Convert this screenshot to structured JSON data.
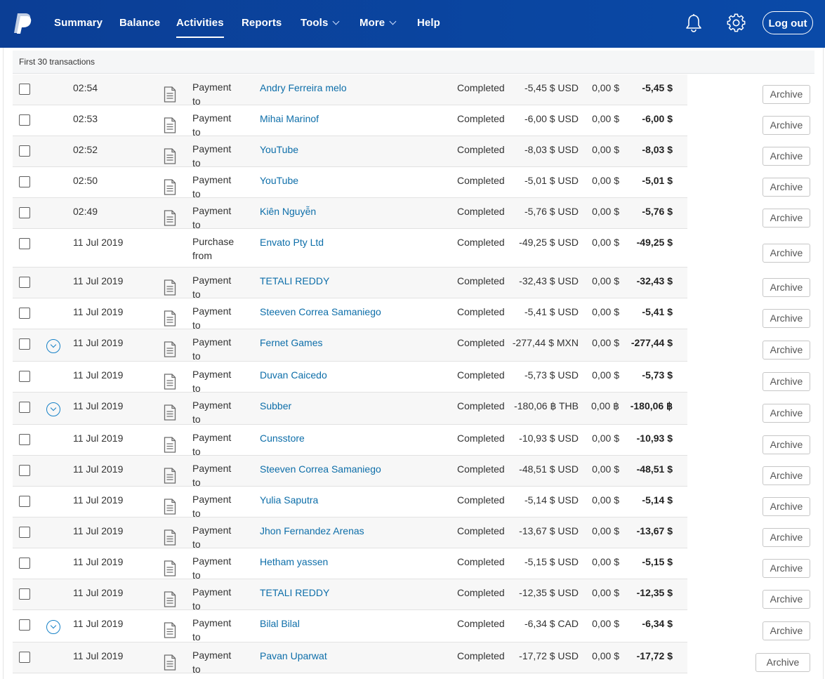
{
  "header": {
    "nav": [
      {
        "label": "Summary"
      },
      {
        "label": "Balance"
      },
      {
        "label": "Activities",
        "active": true
      },
      {
        "label": "Reports"
      },
      {
        "label": "Tools",
        "has_dropdown": true
      },
      {
        "label": "More",
        "has_dropdown": true
      },
      {
        "label": "Help"
      }
    ],
    "icons": [
      "paypal-logo",
      "bell-icon",
      "gear-icon"
    ],
    "logout_label": "Log out",
    "brand_color": "#0a3c93"
  },
  "table": {
    "caption": "First 30 transactions",
    "archive_label": "Archive",
    "link_color": "#0d6ea9",
    "rows": [
      {
        "date": "02:54",
        "type": "Payment to",
        "name": "Andry Ferreira melo",
        "status": "Completed",
        "gross": "-5,45 $ USD",
        "fee": "0,00 $",
        "net": "-5,45 $",
        "has_doc": true,
        "expandable": false
      },
      {
        "date": "02:53",
        "type": "Payment to",
        "name": "Mihai Marinof",
        "status": "Completed",
        "gross": "-6,00 $ USD",
        "fee": "0,00 $",
        "net": "-6,00 $",
        "has_doc": true,
        "expandable": false
      },
      {
        "date": "02:52",
        "type": "Payment to",
        "name": "YouTube",
        "status": "Completed",
        "gross": "-8,03 $ USD",
        "fee": "0,00 $",
        "net": "-8,03 $",
        "has_doc": true,
        "expandable": false
      },
      {
        "date": "02:50",
        "type": "Payment to",
        "name": "YouTube",
        "status": "Completed",
        "gross": "-5,01 $ USD",
        "fee": "0,00 $",
        "net": "-5,01 $",
        "has_doc": true,
        "expandable": false
      },
      {
        "date": "02:49",
        "type": "Payment to",
        "name": "Kiên Nguyễn",
        "status": "Completed",
        "gross": "-5,76 $ USD",
        "fee": "0,00 $",
        "net": "-5,76 $",
        "has_doc": true,
        "expandable": false
      },
      {
        "date": "11 Jul 2019",
        "type": "Purchase from",
        "name": "Envato Pty Ltd",
        "status": "Completed",
        "gross": "-49,25 $ USD",
        "fee": "0,00 $",
        "net": "-49,25 $",
        "has_doc": false,
        "expandable": false
      },
      {
        "date": "11 Jul 2019",
        "type": "Payment to",
        "name": "TETALI REDDY",
        "status": "Completed",
        "gross": "-32,43 $ USD",
        "fee": "0,00 $",
        "net": "-32,43 $",
        "has_doc": true,
        "expandable": false
      },
      {
        "date": "11 Jul 2019",
        "type": "Payment to",
        "name": "Steeven Correa Samaniego",
        "status": "Completed",
        "gross": "-5,41 $ USD",
        "fee": "0,00 $",
        "net": "-5,41 $",
        "has_doc": true,
        "expandable": false
      },
      {
        "date": "11 Jul 2019",
        "type": "Payment to",
        "name": "Fernet Games",
        "status": "Completed",
        "gross": "-277,44 $ MXN",
        "fee": "0,00 $",
        "net": "-277,44 $",
        "has_doc": true,
        "expandable": true
      },
      {
        "date": "11 Jul 2019",
        "type": "Payment to",
        "name": "Duvan Caicedo",
        "status": "Completed",
        "gross": "-5,73 $ USD",
        "fee": "0,00 $",
        "net": "-5,73 $",
        "has_doc": true,
        "expandable": false
      },
      {
        "date": "11 Jul 2019",
        "type": "Payment to",
        "name": "Subber",
        "status": "Completed",
        "gross": "-180,06 ฿ THB",
        "fee": "0,00 ฿",
        "net": "-180,06 ฿",
        "has_doc": true,
        "expandable": true
      },
      {
        "date": "11 Jul 2019",
        "type": "Payment to",
        "name": "Cunsstore",
        "status": "Completed",
        "gross": "-10,93 $ USD",
        "fee": "0,00 $",
        "net": "-10,93 $",
        "has_doc": true,
        "expandable": false
      },
      {
        "date": "11 Jul 2019",
        "type": "Payment to",
        "name": "Steeven Correa Samaniego",
        "status": "Completed",
        "gross": "-48,51 $ USD",
        "fee": "0,00 $",
        "net": "-48,51 $",
        "has_doc": true,
        "expandable": false
      },
      {
        "date": "11 Jul 2019",
        "type": "Payment to",
        "name": "Yulia Saputra",
        "status": "Completed",
        "gross": "-5,14 $ USD",
        "fee": "0,00 $",
        "net": "-5,14 $",
        "has_doc": true,
        "expandable": false
      },
      {
        "date": "11 Jul 2019",
        "type": "Payment to",
        "name": "Jhon Fernandez Arenas",
        "status": "Completed",
        "gross": "-13,67 $ USD",
        "fee": "0,00 $",
        "net": "-13,67 $",
        "has_doc": true,
        "expandable": false
      },
      {
        "date": "11 Jul 2019",
        "type": "Payment to",
        "name": "Hetham yassen",
        "status": "Completed",
        "gross": "-5,15 $ USD",
        "fee": "0,00 $",
        "net": "-5,15 $",
        "has_doc": true,
        "expandable": false
      },
      {
        "date": "11 Jul 2019",
        "type": "Payment to",
        "name": "TETALI REDDY",
        "status": "Completed",
        "gross": "-12,35 $ USD",
        "fee": "0,00 $",
        "net": "-12,35 $",
        "has_doc": true,
        "expandable": false
      },
      {
        "date": "11 Jul 2019",
        "type": "Payment to",
        "name": "Bilal Bilal",
        "status": "Completed",
        "gross": "-6,34 $ CAD",
        "fee": "0,00 $",
        "net": "-6,34 $",
        "has_doc": true,
        "expandable": true
      },
      {
        "date": "11 Jul 2019",
        "type": "Payment to",
        "name": "Pavan Uparwat",
        "status": "Completed",
        "gross": "-17,72 $ USD",
        "fee": "0,00 $",
        "net": "-17,72 $",
        "has_doc": true,
        "expandable": false
      }
    ]
  }
}
